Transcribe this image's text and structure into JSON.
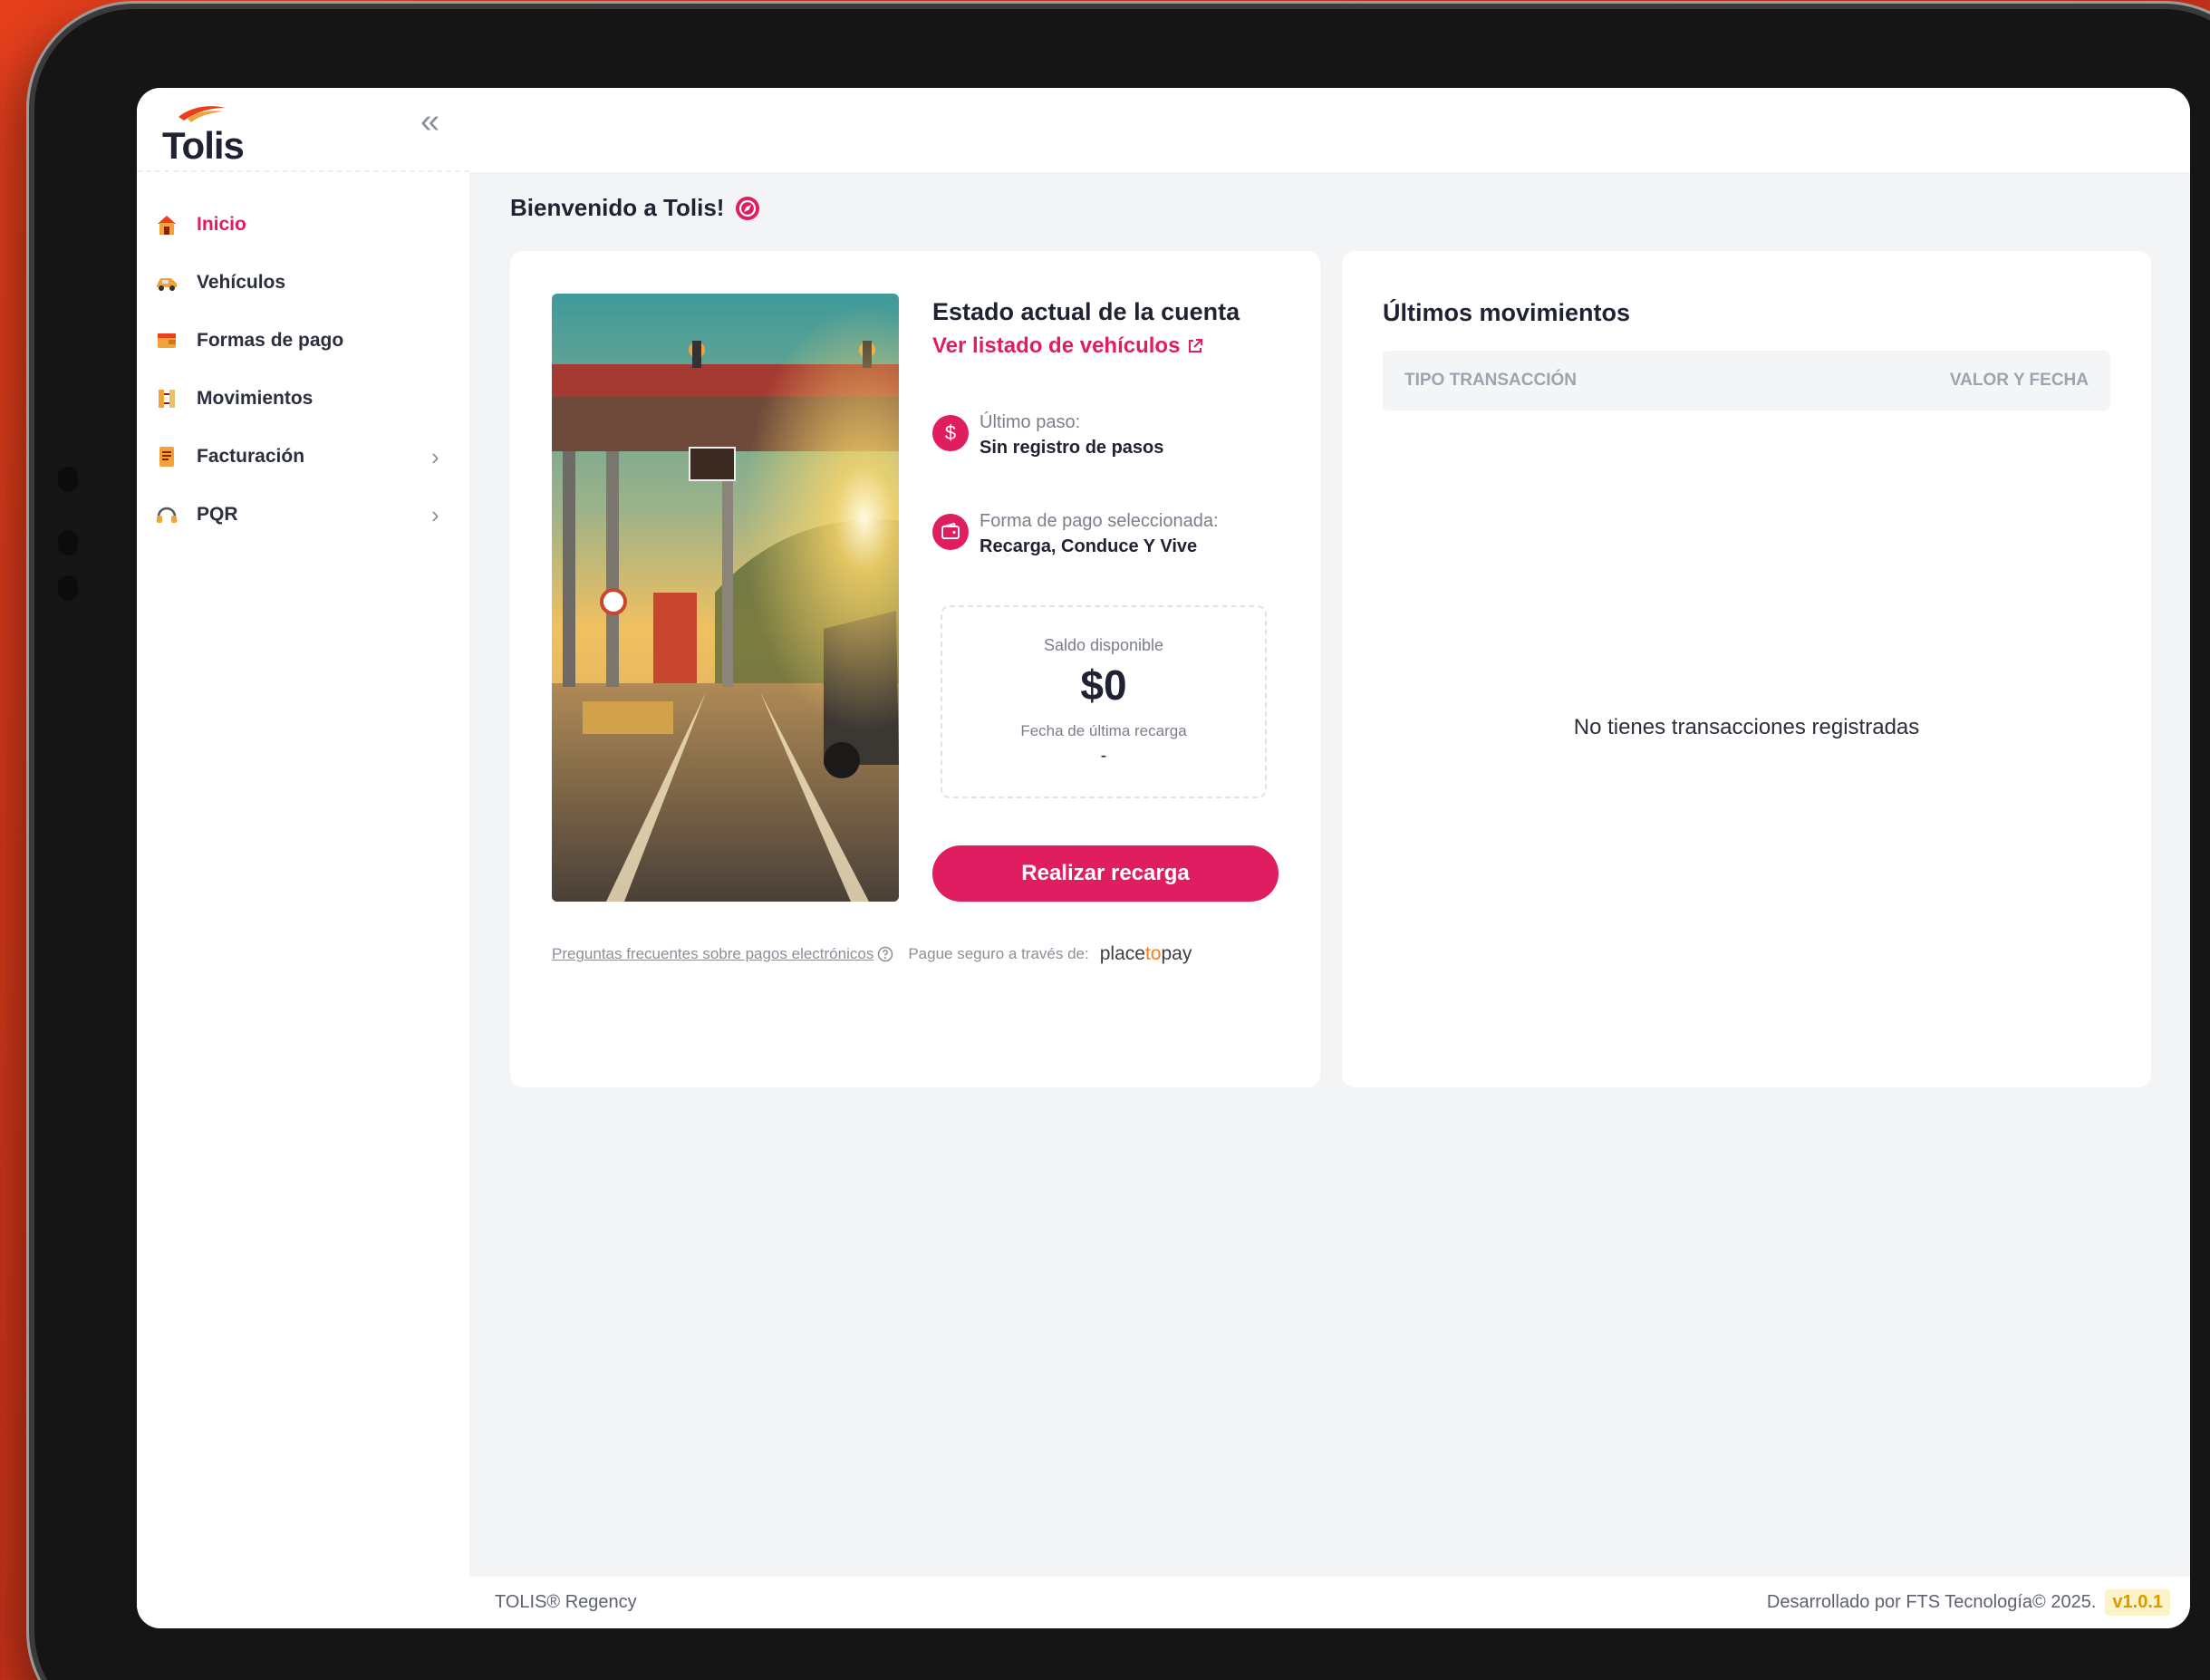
{
  "brand": {
    "name": "Tolis"
  },
  "sidebar": {
    "items": [
      {
        "label": "Inicio",
        "active": true
      },
      {
        "label": "Vehículos"
      },
      {
        "label": "Formas de pago"
      },
      {
        "label": "Movimientos"
      },
      {
        "label": "Facturación",
        "chevron": true
      },
      {
        "label": "PQR",
        "chevron": true
      }
    ]
  },
  "main": {
    "welcome": "Bienvenido a Tolis!",
    "account": {
      "title": "Estado actual de la cuenta",
      "link": "Ver listado de vehículos",
      "last_pass_label": "Último paso:",
      "last_pass_value": "Sin registro de pasos",
      "payment_label": "Forma de pago seleccionada:",
      "payment_value": "Recarga, Conduce Y Vive",
      "balance_label": "Saldo disponible",
      "balance_value": "$0",
      "last_recharge_label": "Fecha de última recarga",
      "last_recharge_value": "-",
      "recharge_button": "Realizar recarga",
      "faq_link": "Preguntas frecuentes sobre pagos electrónicos",
      "secure_text": "Pague seguro a través de:",
      "provider_a": "place",
      "provider_b": "to",
      "provider_c": "pay"
    },
    "movements": {
      "title": "Últimos movimientos",
      "col_type": "TIPO TRANSACCIÓN",
      "col_value": "VALOR Y FECHA",
      "empty": "No tienes transacciones registradas"
    }
  },
  "footer": {
    "left": "TOLIS® Regency",
    "right": "Desarrollado por FTS Tecnología© 2025.",
    "version": "v1.0.1"
  },
  "colors": {
    "accent": "#e11d62",
    "text": "#1f2233",
    "muted": "#7a7f8b",
    "background": "#f3f4f6"
  }
}
